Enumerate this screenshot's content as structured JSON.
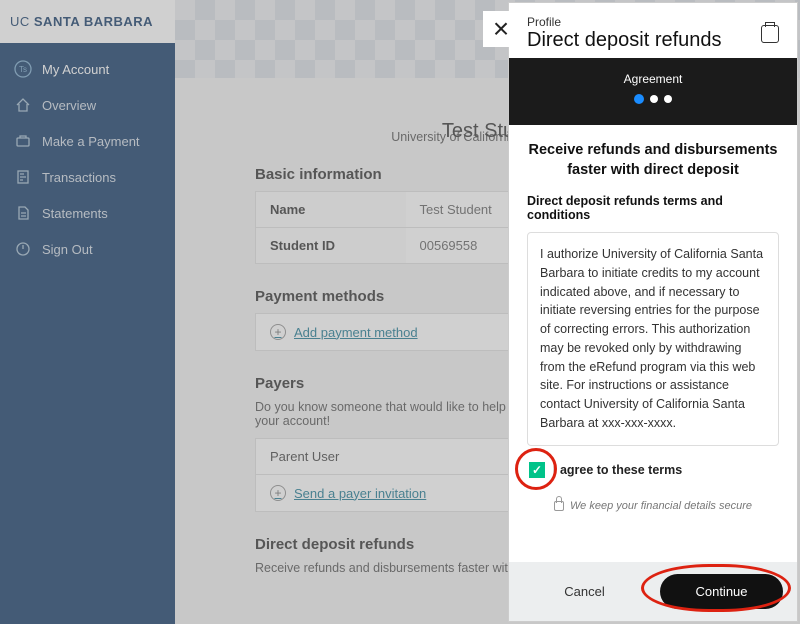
{
  "brand": {
    "part1": "UC ",
    "part2": "SANTA BARBARA"
  },
  "nav": {
    "account": "My Account",
    "overview": "Overview",
    "payment": "Make a Payment",
    "trans": "Transactions",
    "stmts": "Statements",
    "signout": "Sign Out"
  },
  "avatar": {
    "a": "T",
    "b": "s"
  },
  "page": {
    "title": "Test Student",
    "subtitle": "University of California, Santa Barbara"
  },
  "basic": {
    "heading": "Basic information",
    "row1_label": "Name",
    "row1_value": "Test Student",
    "row2_label": "Student ID",
    "row2_value": "00569558"
  },
  "methods": {
    "heading": "Payment methods",
    "add_link": "Add payment method"
  },
  "payers": {
    "heading": "Payers",
    "note": "Do you know someone that would like to help you pay? Invite them to have access to your account!",
    "row1": "Parent User",
    "invite_link": "Send a payer invitation"
  },
  "refunds": {
    "heading": "Direct deposit refunds",
    "note": "Receive refunds and disbursements faster with direct deposit"
  },
  "panel": {
    "profile_label": "Profile",
    "title": "Direct deposit refunds",
    "step_label": "Agreement",
    "headline": "Receive refunds and disbursements faster with direct deposit",
    "tc_heading": "Direct deposit refunds terms and conditions",
    "tc_text": "I authorize University of California Santa Barbara to initiate credits to my account indicated above, and if necessary to initiate reversing entries for the purpose of correcting errors. This authorization may be revoked only by withdrawing from the eRefund program via this web site. For instructions or assistance contact University of California Santa Barbara at xxx-xxx-xxxx.",
    "agree_label": "I agree to these terms",
    "secure_note": "We keep your financial details secure",
    "cancel": "Cancel",
    "continue": "Continue"
  }
}
